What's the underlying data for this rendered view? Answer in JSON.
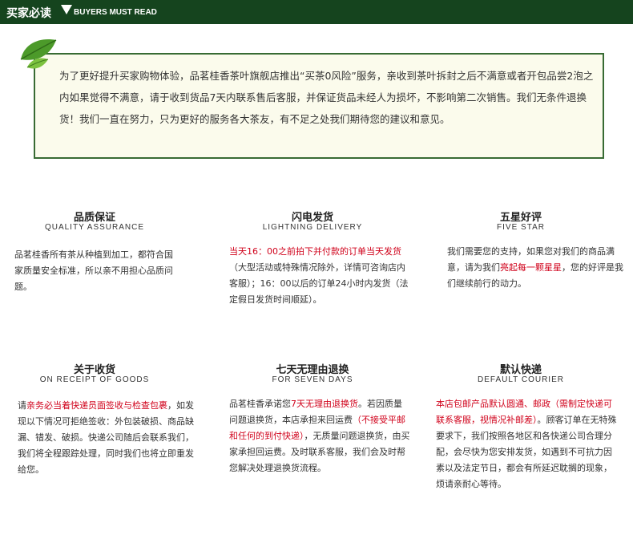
{
  "header": {
    "title_cn": "买家必读",
    "title_en": "BUYERS MUST READ"
  },
  "notice": {
    "text": "为了更好提升买家购物体验，品茗桂香茶叶旗舰店推出“买茶0风险”服务，亲收到茶叶拆封之后不满意或者开包品尝2泡之内如果觉得不满意，请于收到货品7天内联系售后客服，并保证货品未经人为损坏，不影响第二次销售。我们无条件退换货！我们一直在努力，只为更好的服务各大茶友，有不足之处我们期待您的建议和意见。"
  },
  "features": {
    "quality": {
      "title": "品质保证",
      "subtitle": "QUALITY ASSURANCE",
      "body": "品茗桂香所有茶从种植到加工，都符合国家质量安全标准，所以亲不用担心品质问题。"
    },
    "shipping": {
      "title": "闪电发货",
      "subtitle": "LIGHTNING DELIVERY",
      "body_red": "当天16：00之前拍下并付款的订单当天发货",
      "body_rest": "（大型活动或特殊情况除外，详情可咨询店内客服）；16：00以后的订单24小时内发货（法定假日发货时间顺延）。"
    },
    "rating": {
      "title": "五星好评",
      "subtitle": "FIVE STAR",
      "body_a": "我们需要您的支持，如果您对我们的商品满意，请为我们",
      "body_red": "亮起每一颗星星",
      "body_b": "，您的好评是我们继续前行的动力。"
    },
    "receipt": {
      "title": "关于收货",
      "subtitle": "ON RECEIPT OF GOODS",
      "body_a": "请",
      "body_red": "亲务必当着快递员面签收与检查包裹",
      "body_b": "，如发现以下情况可拒绝签收：外包装破损、商品缺漏、错发、破损。快递公司随后会联系我们，我们将全程跟踪处理，同时我们也将立即重发给您。"
    },
    "returns": {
      "title": "七天无理由退换",
      "subtitle": "FOR SEVEN DAYS",
      "body_a": "品茗桂香承诺您",
      "body_red1": "7天无理由退换货",
      "body_b": "。若因质量问题退换货，本店承担来回运费",
      "body_red2": "（不接受平邮和任何的到付快递）",
      "body_c": "，无质量问题退换货，由买家承担回运费。及时联系客服，我们会及时帮您解决处理退换货流程。"
    },
    "courier": {
      "title": "默认快递",
      "subtitle": "DEFAULT COURIER",
      "body_red": "本店包邮产品默认圆通、邮政（需制定快递可联系客服，视情况补邮差）",
      "body_rest": "。顾客订单在无特殊要求下，我们按照各地区和各快递公司合理分配，会尽快为您安排发货，如遇到不可抗力因素以及法定节日，都会有所延迟耽搁的现象，烦请亲耐心等待。"
    }
  },
  "colors": {
    "header_bg": "#15441e",
    "border_green": "#386b34",
    "notice_bg": "#fbfbec",
    "accent_red": "#d0021b"
  }
}
